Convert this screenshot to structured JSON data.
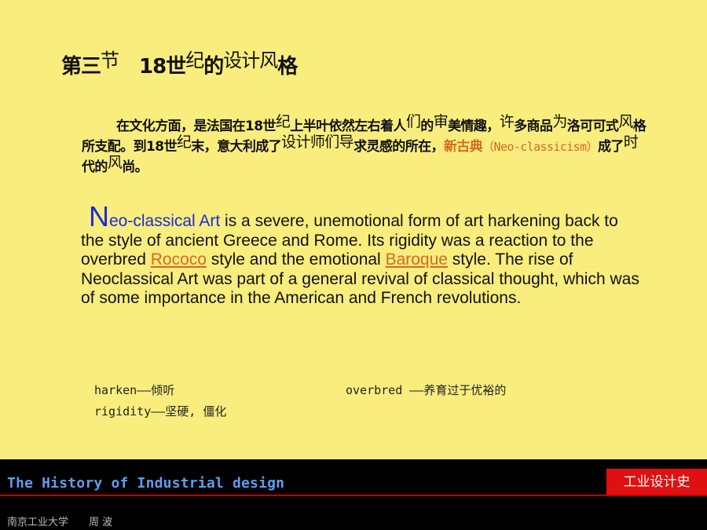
{
  "title": {
    "a": "第三",
    "b": "节",
    "c": "18世",
    "d": "纪",
    "e": "的",
    "f": "设计风",
    "g": "格"
  },
  "cn_paragraph": {
    "s1": "在文化方面，是法国在18世",
    "s2": "纪",
    "s3": "上半叶依然左右着人",
    "s4": "们",
    "s5": "的",
    "s6": "审",
    "s7": "美情趣，",
    "s8": "许",
    "s9": "多商品",
    "s10": "为",
    "s11": "洛可可式",
    "s12": "风",
    "s13": "格所支配。到18世",
    "s14": "纪",
    "s15": "末，意大利成了",
    "s16": "设计师们导",
    "s17": "求灵感的所在，",
    "s18": "新古典",
    "s19": "（Neo-classicism）",
    "s20": "成了",
    "s21": "时",
    "s22": "代的",
    "s23": "风",
    "s24": "尚。"
  },
  "en_paragraph": {
    "initial": "N",
    "term": "eo-classical Art",
    "text1": " is a severe, unemotional form of art harkening back to the style of ancient Greece and Rome. Its rigidity was a reaction to the overbred ",
    "link_rococo": "Rococo",
    "text2": " style and the emotional ",
    "link_baroque": "Baroque",
    "text3": " style. The rise of Neoclassical Art was part of a general revival of classical thought, which was of some importance in the American and French revolutions."
  },
  "glossary": {
    "harken": "harken——倾听",
    "overbred": "overbred ——养育过于优裕的",
    "rigidity": "rigidity——坚硬, 僵化"
  },
  "footer": {
    "course_title": "The History of Industrial design",
    "badge": "工业设计史",
    "author": "南京工业大学　　周 波"
  },
  "colors": {
    "background": "#f9ed7e",
    "accent_orange": "#d8691e",
    "term_blue": "#1c2bd8",
    "footer_title": "#5aa0ee",
    "badge_red": "#e01010"
  }
}
